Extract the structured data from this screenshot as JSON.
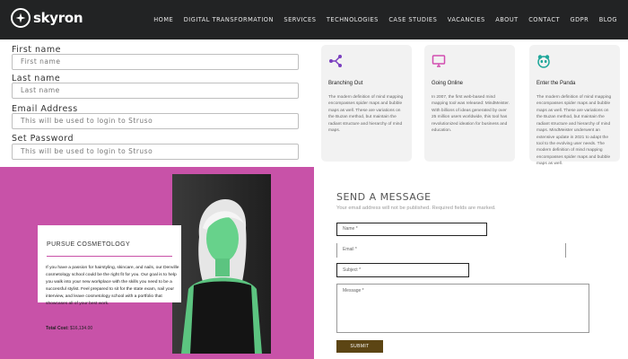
{
  "nav": {
    "logo": "skyron",
    "items": [
      "HOME",
      "DIGITAL TRANSFORMATION",
      "SERVICES",
      "TECHNOLOGIES",
      "CASE STUDIES",
      "VACANCIES",
      "ABOUT",
      "CONTACT",
      "GDPR",
      "BLOG"
    ]
  },
  "signup": {
    "first_name": {
      "label": "First name",
      "placeholder": "First name"
    },
    "last_name": {
      "label": "Last name",
      "placeholder": "Last name"
    },
    "email": {
      "label": "Email Address",
      "placeholder": "This will be used to login to Struso"
    },
    "password": {
      "label": "Set Password",
      "placeholder": "This will be used to login to Struso"
    }
  },
  "cards": [
    {
      "icon": "branch-icon",
      "icon_color": "#7b3fbf",
      "title": "Branching Out",
      "body": "The modern definition of mind mapping encompasses spider maps and bubble maps as well. These are variations on the Buzan method, but maintain the radiant structure and hierarchy of mind maps."
    },
    {
      "icon": "monitor-icon",
      "icon_color": "#d24db0",
      "title": "Going Online",
      "body": "In 2007, the first web-based mind mapping tool was released: MindMeister. With billions of ideas generated by over 25 million users worldwide, this tool has revolutionized ideation for business and education."
    },
    {
      "icon": "panda-icon",
      "icon_color": "#1fa79a",
      "title": "Enter the Panda",
      "body": "The modern definition of mind mapping encompasses spider maps and bubble maps as well. These are variations on the Buzan method, but maintain the radiant structure and hierarchy of mind maps. MindMeister underwent an extensive update in 2021 to adapt the tool to the evolving user needs. The modern definition of mind mapping encompasses spider maps and bubble maps as well."
    }
  ],
  "promo": {
    "title": "PURSUE COSMETOLOGY",
    "text": "If you have a passion for hairstyling, skincare, and nails, our Denville cosmetology school could be the right fit for you. Our goal is to help you walk into your new workplace with the skills you need to be a successful stylist. Feel prepared to sit for the state exam, nail your interview, and leave cosmetology school with a portfolio that showcases all of your best work.",
    "cost_label": "Total Cost:",
    "cost_value": "$16,134.00"
  },
  "contact": {
    "title": "SEND A MESSAGE",
    "note": "Your email address will not be published. Required fields are marked.",
    "name_placeholder": "Name *",
    "email_placeholder": "Email *",
    "subject_placeholder": "Subject *",
    "message_placeholder": "Message *",
    "submit": "SUBMIT"
  }
}
